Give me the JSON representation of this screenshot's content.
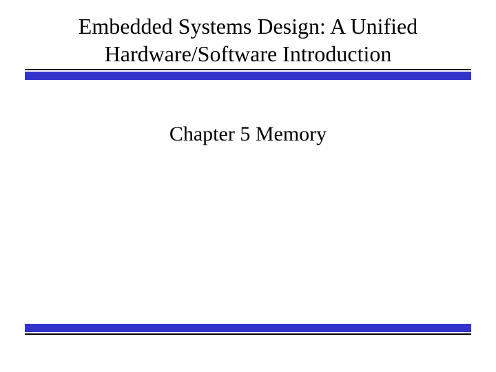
{
  "slide": {
    "title_line1": "Embedded Systems Design: A Unified",
    "title_line2": "Hardware/Software Introduction",
    "subtitle": "Chapter 5 Memory"
  },
  "colors": {
    "rule_blue": "#3333cc",
    "rule_black": "#000000"
  }
}
